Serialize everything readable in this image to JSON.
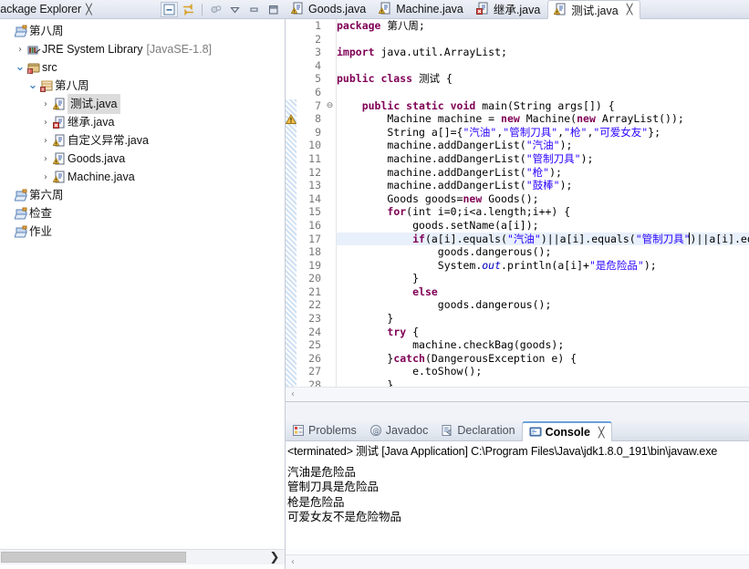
{
  "explorer": {
    "title": "Package Explorer",
    "close_glyph": "╳",
    "toolbar": [
      {
        "name": "collapse-all-icon",
        "glyph": "⊟"
      },
      {
        "name": "link-with-editor-icon",
        "glyph": "⇄"
      },
      {
        "name": "focus-on-active-task-icon",
        "glyph": "⚙"
      },
      {
        "name": "view-menu-icon",
        "glyph": "▽"
      },
      {
        "name": "minimize-icon",
        "glyph": "▬"
      },
      {
        "name": "maximize-icon",
        "glyph": "☐"
      }
    ],
    "tree": [
      {
        "label": "第八周",
        "indent": 0,
        "arrow": "",
        "icon": "project-icon",
        "selected": false,
        "suffix": ""
      },
      {
        "label": "JRE System Library",
        "indent": 1,
        "arrow": "›",
        "icon": "library-icon",
        "selected": false,
        "suffix": "[JavaSE-1.8]"
      },
      {
        "label": "src",
        "indent": 1,
        "arrow": "⌄",
        "icon": "source-folder-icon",
        "selected": false,
        "suffix": ""
      },
      {
        "label": "第八周",
        "indent": 2,
        "arrow": "⌄",
        "icon": "package-icon",
        "selected": false,
        "suffix": ""
      },
      {
        "label": "测试.java",
        "indent": 3,
        "arrow": "›",
        "icon": "java-file-warning-icon",
        "selected": true,
        "suffix": ""
      },
      {
        "label": "继承.java",
        "indent": 3,
        "arrow": "›",
        "icon": "java-file-error-icon",
        "selected": false,
        "suffix": ""
      },
      {
        "label": "自定义异常.java",
        "indent": 3,
        "arrow": "›",
        "icon": "java-file-warning-icon",
        "selected": false,
        "suffix": ""
      },
      {
        "label": "Goods.java",
        "indent": 3,
        "arrow": "›",
        "icon": "java-file-warning-icon",
        "selected": false,
        "suffix": ""
      },
      {
        "label": "Machine.java",
        "indent": 3,
        "arrow": "›",
        "icon": "java-file-warning-icon",
        "selected": false,
        "suffix": ""
      },
      {
        "label": "第六周",
        "indent": 0,
        "arrow": "",
        "icon": "project-icon",
        "selected": false,
        "suffix": ""
      },
      {
        "label": "检查",
        "indent": 0,
        "arrow": "",
        "icon": "project-icon",
        "selected": false,
        "suffix": ""
      },
      {
        "label": "作业",
        "indent": 0,
        "arrow": "",
        "icon": "project-icon",
        "selected": false,
        "suffix": ""
      }
    ],
    "hscroll_right_glyph": "❯"
  },
  "editor": {
    "tabs": [
      {
        "label": "Goods.java",
        "icon": "java-file-warning-icon",
        "active": false,
        "close": ""
      },
      {
        "label": "Machine.java",
        "icon": "java-file-warning-icon",
        "active": false,
        "close": ""
      },
      {
        "label": "继承.java",
        "icon": "java-file-error-icon",
        "active": false,
        "close": ""
      },
      {
        "label": "测试.java",
        "icon": "java-file-warning-icon",
        "active": true,
        "close": "╳"
      }
    ],
    "lines": [
      {
        "n": 1,
        "fold": "",
        "hl": false,
        "marker": "",
        "tokens": [
          {
            "t": "kw",
            "s": "package"
          },
          {
            "t": "plain",
            "s": " 第八周;"
          }
        ]
      },
      {
        "n": 2,
        "fold": "",
        "hl": false,
        "marker": "",
        "tokens": [
          {
            "t": "plain",
            "s": ""
          }
        ]
      },
      {
        "n": 3,
        "fold": "",
        "hl": false,
        "marker": "",
        "tokens": [
          {
            "t": "kw",
            "s": "import"
          },
          {
            "t": "plain",
            "s": " java.util.ArrayList;"
          }
        ]
      },
      {
        "n": 4,
        "fold": "",
        "hl": false,
        "marker": "",
        "tokens": [
          {
            "t": "plain",
            "s": ""
          }
        ]
      },
      {
        "n": 5,
        "fold": "",
        "hl": false,
        "marker": "",
        "tokens": [
          {
            "t": "kw",
            "s": "public class"
          },
          {
            "t": "plain",
            "s": " 测试 {"
          }
        ]
      },
      {
        "n": 6,
        "fold": "",
        "hl": false,
        "marker": "",
        "tokens": [
          {
            "t": "plain",
            "s": ""
          }
        ]
      },
      {
        "n": 7,
        "fold": "⊖",
        "hl": false,
        "marker": "",
        "tokens": [
          {
            "t": "plain",
            "s": "    "
          },
          {
            "t": "kw",
            "s": "public static void"
          },
          {
            "t": "plain",
            "s": " main(String args[]) {"
          }
        ]
      },
      {
        "n": 8,
        "fold": "",
        "hl": false,
        "marker": "warning",
        "tokens": [
          {
            "t": "plain",
            "s": "        Machine machine = "
          },
          {
            "t": "kw",
            "s": "new"
          },
          {
            "t": "plain",
            "s": " Machine("
          },
          {
            "t": "kw",
            "s": "new"
          },
          {
            "t": "plain",
            "s": " ArrayList());"
          }
        ]
      },
      {
        "n": 9,
        "fold": "",
        "hl": false,
        "marker": "",
        "tokens": [
          {
            "t": "plain",
            "s": "        String a[]={"
          },
          {
            "t": "str",
            "s": "\"汽油\""
          },
          {
            "t": "plain",
            "s": ","
          },
          {
            "t": "str",
            "s": "\"管制刀具\""
          },
          {
            "t": "plain",
            "s": ","
          },
          {
            "t": "str",
            "s": "\"枪\""
          },
          {
            "t": "plain",
            "s": ","
          },
          {
            "t": "str",
            "s": "\"可爱女友\""
          },
          {
            "t": "plain",
            "s": "};"
          }
        ]
      },
      {
        "n": 10,
        "fold": "",
        "hl": false,
        "marker": "",
        "tokens": [
          {
            "t": "plain",
            "s": "        machine.addDangerList("
          },
          {
            "t": "str",
            "s": "\"汽油\""
          },
          {
            "t": "plain",
            "s": ");"
          }
        ]
      },
      {
        "n": 11,
        "fold": "",
        "hl": false,
        "marker": "",
        "tokens": [
          {
            "t": "plain",
            "s": "        machine.addDangerList("
          },
          {
            "t": "str",
            "s": "\"管制刀具\""
          },
          {
            "t": "plain",
            "s": ");"
          }
        ]
      },
      {
        "n": 12,
        "fold": "",
        "hl": false,
        "marker": "",
        "tokens": [
          {
            "t": "plain",
            "s": "        machine.addDangerList("
          },
          {
            "t": "str",
            "s": "\"枪\""
          },
          {
            "t": "plain",
            "s": ");"
          }
        ]
      },
      {
        "n": 13,
        "fold": "",
        "hl": false,
        "marker": "",
        "tokens": [
          {
            "t": "plain",
            "s": "        machine.addDangerList("
          },
          {
            "t": "str",
            "s": "\"鼓棒\""
          },
          {
            "t": "plain",
            "s": ");"
          }
        ]
      },
      {
        "n": 14,
        "fold": "",
        "hl": false,
        "marker": "",
        "tokens": [
          {
            "t": "plain",
            "s": "        Goods goods="
          },
          {
            "t": "kw",
            "s": "new"
          },
          {
            "t": "plain",
            "s": " Goods();"
          }
        ]
      },
      {
        "n": 15,
        "fold": "",
        "hl": false,
        "marker": "",
        "tokens": [
          {
            "t": "plain",
            "s": "        "
          },
          {
            "t": "kw",
            "s": "for"
          },
          {
            "t": "plain",
            "s": "(int i=0;i<a.length;i++) {"
          }
        ]
      },
      {
        "n": 16,
        "fold": "",
        "hl": false,
        "marker": "",
        "tokens": [
          {
            "t": "plain",
            "s": "            goods.setName(a[i]);"
          }
        ]
      },
      {
        "n": 17,
        "fold": "",
        "hl": true,
        "marker": "",
        "tokens": [
          {
            "t": "plain",
            "s": "            "
          },
          {
            "t": "kw",
            "s": "if"
          },
          {
            "t": "plain",
            "s": "(a[i].equals("
          },
          {
            "t": "str",
            "s": "\"汽油\""
          },
          {
            "t": "plain",
            "s": ")||a[i].equals("
          },
          {
            "t": "str",
            "s": "\"管制刀具\""
          },
          {
            "t": "plain",
            "s": ")||a[i].equal"
          }
        ]
      },
      {
        "n": 18,
        "fold": "",
        "hl": false,
        "marker": "",
        "tokens": [
          {
            "t": "plain",
            "s": "                goods.dangerous();"
          }
        ]
      },
      {
        "n": 19,
        "fold": "",
        "hl": false,
        "marker": "",
        "tokens": [
          {
            "t": "plain",
            "s": "                System."
          },
          {
            "t": "stat",
            "s": "out"
          },
          {
            "t": "plain",
            "s": ".println(a[i]+"
          },
          {
            "t": "str",
            "s": "\"是危险品\""
          },
          {
            "t": "plain",
            "s": ");"
          }
        ]
      },
      {
        "n": 20,
        "fold": "",
        "hl": false,
        "marker": "",
        "tokens": [
          {
            "t": "plain",
            "s": "            }"
          }
        ]
      },
      {
        "n": 21,
        "fold": "",
        "hl": false,
        "marker": "",
        "tokens": [
          {
            "t": "plain",
            "s": "            "
          },
          {
            "t": "kw",
            "s": "else"
          }
        ]
      },
      {
        "n": 22,
        "fold": "",
        "hl": false,
        "marker": "",
        "tokens": [
          {
            "t": "plain",
            "s": "                goods.dangerous();"
          }
        ]
      },
      {
        "n": 23,
        "fold": "",
        "hl": false,
        "marker": "",
        "tokens": [
          {
            "t": "plain",
            "s": "        }"
          }
        ]
      },
      {
        "n": 24,
        "fold": "",
        "hl": false,
        "marker": "",
        "tokens": [
          {
            "t": "plain",
            "s": "        "
          },
          {
            "t": "kw",
            "s": "try"
          },
          {
            "t": "plain",
            "s": " {"
          }
        ]
      },
      {
        "n": 25,
        "fold": "",
        "hl": false,
        "marker": "",
        "tokens": [
          {
            "t": "plain",
            "s": "            machine.checkBag(goods);"
          }
        ]
      },
      {
        "n": 26,
        "fold": "",
        "hl": false,
        "marker": "",
        "tokens": [
          {
            "t": "plain",
            "s": "        }"
          },
          {
            "t": "kw",
            "s": "catch"
          },
          {
            "t": "plain",
            "s": "(DangerousException e) {"
          }
        ]
      },
      {
        "n": 27,
        "fold": "",
        "hl": false,
        "marker": "",
        "tokens": [
          {
            "t": "plain",
            "s": "            e.toShow();"
          }
        ]
      },
      {
        "n": 28,
        "fold": "",
        "hl": false,
        "marker": "",
        "tokens": [
          {
            "t": "plain",
            "s": "        }"
          }
        ]
      }
    ],
    "hscroll_left_glyph": "‹"
  },
  "console": {
    "tabs": [
      {
        "label": "Problems",
        "icon": "problems-icon",
        "active": false,
        "close": ""
      },
      {
        "label": "Javadoc",
        "icon": "javadoc-icon",
        "active": false,
        "close": ""
      },
      {
        "label": "Declaration",
        "icon": "declaration-icon",
        "active": false,
        "close": ""
      },
      {
        "label": "Console",
        "icon": "console-icon",
        "active": true,
        "close": "╳"
      }
    ],
    "header": "<terminated> 测试 [Java Application] C:\\Program Files\\Java\\jdk1.8.0_191\\bin\\javaw.exe",
    "output": [
      "汽油是危险品",
      "管制刀具是危险品",
      "枪是危险品",
      "可爱女友不是危险物品"
    ],
    "hscroll_left_glyph": "‹"
  },
  "colors": {
    "keyword": "#7f0055",
    "string": "#2a00ff",
    "selection": "#dcdcdc",
    "current_line": "#e8f0fb",
    "tab_accent": "#6aa0d8"
  }
}
